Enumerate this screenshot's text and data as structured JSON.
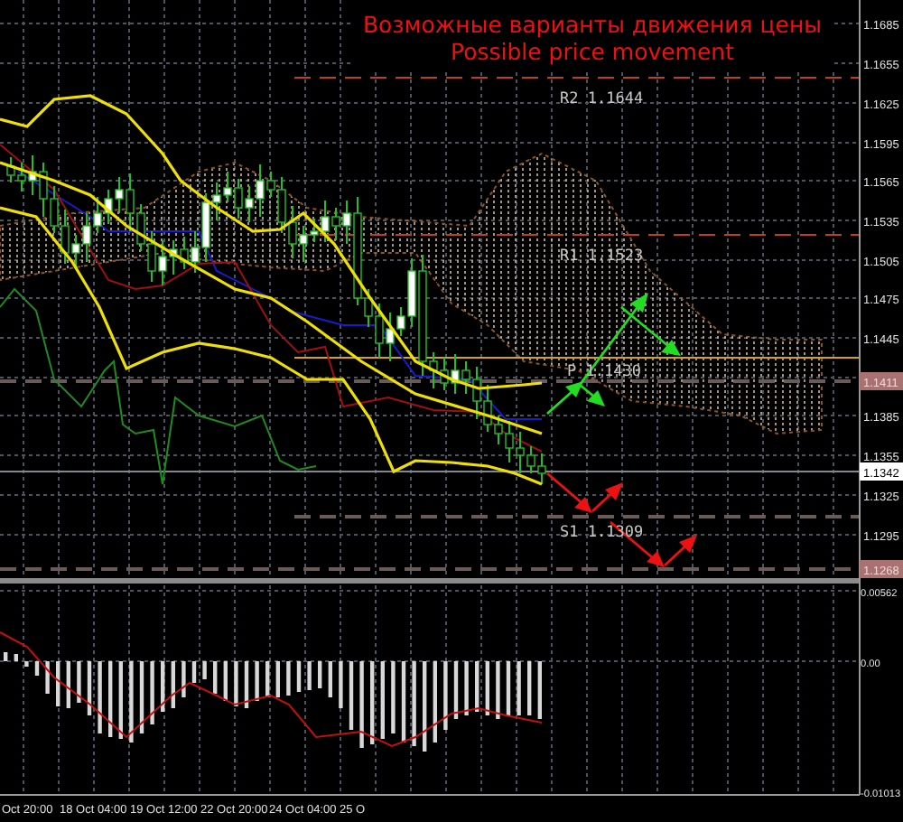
{
  "title": {
    "line_1": "Возможные варианты движения цены",
    "line_2": "Possible price movement"
  },
  "price_axis": {
    "ticks": [
      "1.1685",
      "1.1655",
      "1.1625",
      "1.1595",
      "1.1565",
      "1.1535",
      "1.1505",
      "1.1475",
      "1.1445",
      "1.1385",
      "1.1355",
      "1.1325",
      "1.1295"
    ]
  },
  "price_tags": [
    {
      "text": "1.1411",
      "kind": "level"
    },
    {
      "text": "1.1342",
      "kind": "bid"
    },
    {
      "text": "1.1268",
      "kind": "level"
    }
  ],
  "levels": [
    {
      "label": "R2 1.1644",
      "kind": "resistance"
    },
    {
      "label": "R1 1.1523",
      "kind": "resistance"
    },
    {
      "label": "P 1.1430",
      "kind": "pivot"
    },
    {
      "label": "S1 1.1309",
      "kind": "support"
    }
  ],
  "macd_axis": {
    "ticks": [
      "0.00562",
      "0.00",
      "-0.01013"
    ]
  },
  "time_axis": {
    "labels": [
      "Oct 20:00",
      "18 Oct 04:00",
      "19 Oct 12:00",
      "22 Oct 20:00",
      "24 Oct 04:00",
      "25 O"
    ]
  }
}
